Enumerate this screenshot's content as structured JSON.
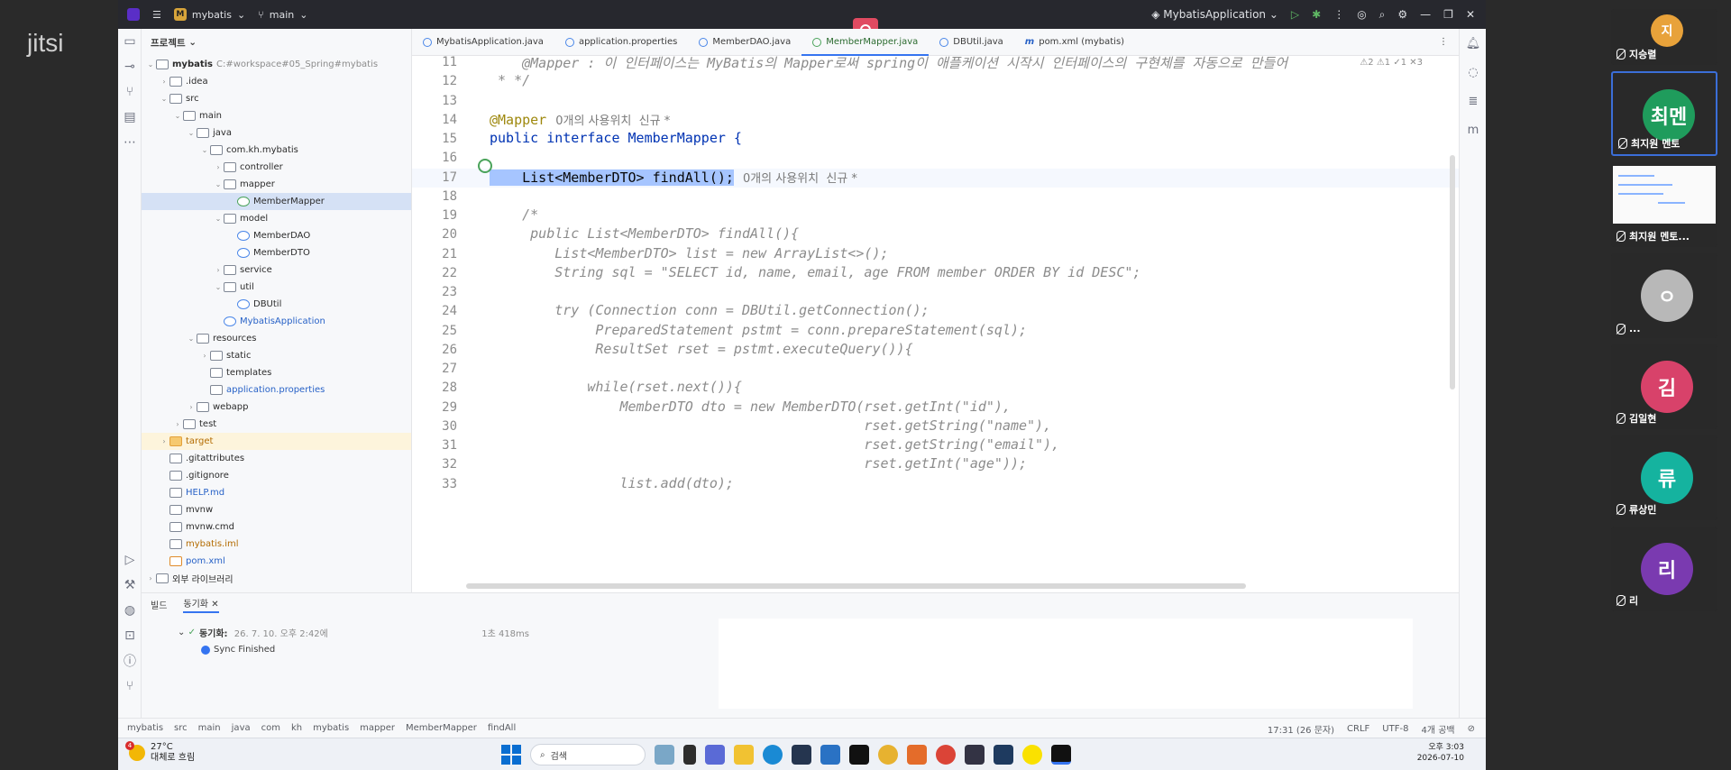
{
  "meeting": {
    "brand": "jitsi"
  },
  "ide": {
    "project_name": "mybatis",
    "branch": "main",
    "run_config": "MybatisApplication",
    "recording_icon": "record-icon"
  },
  "project_panel": {
    "title": "프로젝트",
    "tree": [
      {
        "label": "mybatis",
        "extra": "C:#workspace#05_Spring#mybatis",
        "depth": 0,
        "icon": "folder",
        "open": true,
        "bold": true
      },
      {
        "label": ".idea",
        "depth": 1,
        "icon": "folder",
        "open": false
      },
      {
        "label": "src",
        "depth": 1,
        "icon": "folder",
        "open": true
      },
      {
        "label": "main",
        "depth": 2,
        "icon": "folder",
        "open": true
      },
      {
        "label": "java",
        "depth": 3,
        "icon": "folder",
        "open": true
      },
      {
        "label": "com.kh.mybatis",
        "depth": 4,
        "icon": "package",
        "open": true
      },
      {
        "label": "controller",
        "depth": 5,
        "icon": "package",
        "open": false
      },
      {
        "label": "mapper",
        "depth": 5,
        "icon": "package",
        "open": true
      },
      {
        "label": "MemberMapper",
        "depth": 6,
        "icon": "interface",
        "selected": true
      },
      {
        "label": "model",
        "depth": 5,
        "icon": "package",
        "open": true
      },
      {
        "label": "MemberDAO",
        "depth": 6,
        "icon": "class"
      },
      {
        "label": "MemberDTO",
        "depth": 6,
        "icon": "class"
      },
      {
        "label": "service",
        "depth": 5,
        "icon": "package",
        "open": false
      },
      {
        "label": "util",
        "depth": 5,
        "icon": "package",
        "open": true
      },
      {
        "label": "DBUtil",
        "depth": 6,
        "icon": "class"
      },
      {
        "label": "MybatisApplication",
        "depth": 5,
        "icon": "class",
        "blue": true
      },
      {
        "label": "resources",
        "depth": 3,
        "icon": "folder",
        "open": true
      },
      {
        "label": "static",
        "depth": 4,
        "icon": "folder",
        "open": false
      },
      {
        "label": "templates",
        "depth": 4,
        "icon": "folder"
      },
      {
        "label": "application.properties",
        "depth": 4,
        "icon": "file",
        "blue": true
      },
      {
        "label": "webapp",
        "depth": 3,
        "icon": "folder",
        "open": false
      },
      {
        "label": "test",
        "depth": 2,
        "icon": "folder",
        "open": false
      },
      {
        "label": "target",
        "depth": 1,
        "icon": "orange-folder",
        "open": false,
        "highlight": true,
        "orange": true
      },
      {
        "label": ".gitattributes",
        "depth": 1,
        "icon": "file"
      },
      {
        "label": ".gitignore",
        "depth": 1,
        "icon": "file"
      },
      {
        "label": "HELP.md",
        "depth": 1,
        "icon": "md",
        "blue": true
      },
      {
        "label": "mvnw",
        "depth": 1,
        "icon": "file"
      },
      {
        "label": "mvnw.cmd",
        "depth": 1,
        "icon": "file"
      },
      {
        "label": "mybatis.iml",
        "depth": 1,
        "icon": "file",
        "orange": true
      },
      {
        "label": "pom.xml",
        "depth": 1,
        "icon": "xml",
        "blue": true
      },
      {
        "label": "외부 라이브러리",
        "depth": 0,
        "icon": "library",
        "open": false
      }
    ]
  },
  "tabs": [
    {
      "label": "MybatisApplication.java"
    },
    {
      "label": "application.properties"
    },
    {
      "label": "MemberDAO.java"
    },
    {
      "label": "MemberMapper.java",
      "active": true
    },
    {
      "label": "DBUtil.java"
    },
    {
      "label": "pom.xml (mybatis)",
      "maven": true
    }
  ],
  "editor": {
    "inspections": "⚠2 ⚠1 ✓1 ✕3",
    "lines": [
      {
        "n": "11",
        "text": "    @Mapper : 이 인터페이스는 MyBatis의 Mapper로써 spring이 애플케이션 시작시 인터페이스의 구현체를 자동으로 만들어 ",
        "type": "comment"
      },
      {
        "n": "12",
        "text": " * */",
        "type": "comment"
      },
      {
        "n": "13",
        "text": "",
        "type": "plain"
      },
      {
        "n": "14",
        "text": "@Mapper",
        "type": "annotation",
        "hint": "0개의 사용위치  신규 *"
      },
      {
        "n": "15",
        "text": "public interface MemberMapper {",
        "type": "decl"
      },
      {
        "n": "16",
        "text": "",
        "type": "plain"
      },
      {
        "n": "17",
        "text": "    List<MemberDTO> findAll();",
        "type": "current",
        "hint": "0개의 사용위치  신규 *"
      },
      {
        "n": "18",
        "text": "",
        "type": "plain"
      },
      {
        "n": "19",
        "text": "    /*",
        "type": "comment"
      },
      {
        "n": "20",
        "text": "     public List<MemberDTO> findAll(){",
        "type": "comment"
      },
      {
        "n": "21",
        "text": "        List<MemberDTO> list = new ArrayList<>();",
        "type": "comment"
      },
      {
        "n": "22",
        "text": "        String sql = \"SELECT id, name, email, age FROM member ORDER BY id DESC\";",
        "type": "comment"
      },
      {
        "n": "23",
        "text": "",
        "type": "plain"
      },
      {
        "n": "24",
        "text": "        try (Connection conn = DBUtil.getConnection();",
        "type": "comment"
      },
      {
        "n": "25",
        "text": "             PreparedStatement pstmt = conn.prepareStatement(sql);",
        "type": "comment"
      },
      {
        "n": "26",
        "text": "             ResultSet rset = pstmt.executeQuery()){",
        "type": "comment"
      },
      {
        "n": "27",
        "text": "",
        "type": "plain"
      },
      {
        "n": "28",
        "text": "            while(rset.next()){",
        "type": "comment"
      },
      {
        "n": "29",
        "text": "                MemberDTO dto = new MemberDTO(rset.getInt(\"id\"),",
        "type": "comment"
      },
      {
        "n": "30",
        "text": "                                              rset.getString(\"name\"),",
        "type": "comment"
      },
      {
        "n": "31",
        "text": "                                              rset.getString(\"email\"),",
        "type": "comment"
      },
      {
        "n": "32",
        "text": "                                              rset.getInt(\"age\"));",
        "type": "comment"
      },
      {
        "n": "33",
        "text": "                list.add(dto);",
        "type": "comment"
      }
    ]
  },
  "bottom_panel": {
    "tab_build": "빌드",
    "tab_sync": "동기화",
    "sync_row": "동기화:",
    "sync_time": "26. 7. 10. 오후 2:42에",
    "duration": "1초 418ms",
    "sync_finished": "Sync Finished"
  },
  "status_bar": {
    "breadcrumbs": [
      "mybatis",
      "src",
      "main",
      "java",
      "com",
      "kh",
      "mybatis",
      "mapper",
      "MemberMapper",
      "findAll"
    ],
    "position": "17:31 (26 문자)",
    "line_ending": "CRLF",
    "encoding": "UTF-8",
    "indent": "4개 공백"
  },
  "taskbar": {
    "temperature": "27°C",
    "weather": "대체로 흐림",
    "weather_badge": "4",
    "search_placeholder": "검색",
    "time": "오후 3:03",
    "date": "2026-07-10"
  },
  "participants": [
    {
      "initial": "지",
      "name": "지승렬",
      "color": "#e8a23a",
      "partial": true
    },
    {
      "initial": "최멘",
      "name": "최지원 멘토",
      "color": "#1f9c5c",
      "active": true
    },
    {
      "initial": "",
      "name": "최지원 멘토...",
      "screen_share": true
    },
    {
      "initial": "ㅇ",
      "name": "...",
      "color": "#b8b8b8"
    },
    {
      "initial": "김",
      "name": "김일현",
      "color": "#d8426a"
    },
    {
      "initial": "류",
      "name": "류상민",
      "color": "#15b39f"
    },
    {
      "initial": "리",
      "name": "리",
      "color": "#7a3ab0"
    }
  ]
}
